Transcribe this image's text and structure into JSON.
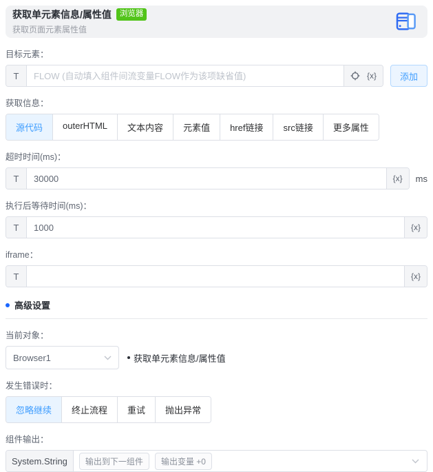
{
  "colors": {
    "accent": "#409eff",
    "accent_light_bg": "#ecf5ff",
    "badge_green": "#52c41a"
  },
  "tokens": {
    "text_prefix": "T",
    "variable": "{x}"
  },
  "header": {
    "title": "获取单元素信息/属性值",
    "badge": "浏览器",
    "subtitle": "获取页面元素属性值",
    "icon": "browser-window-icon"
  },
  "sections": {
    "target": {
      "label": "目标元素：",
      "placeholder": "FLOW (自动填入组件间流变量FLOW作为该项缺省值)",
      "add_button": "添加"
    },
    "info": {
      "label": "获取信息：",
      "options": [
        "源代码",
        "outerHTML",
        "文本内容",
        "元素值",
        "href链接",
        "src链接",
        "更多属性"
      ],
      "selected": "源代码"
    },
    "timeout": {
      "label": "超时时间(ms)：",
      "value": "30000",
      "unit": "ms"
    },
    "wait_after": {
      "label": "执行后等待时间(ms)：",
      "value": "1000"
    },
    "iframe": {
      "label": "iframe：",
      "value": ""
    },
    "advanced": {
      "title": "高级设置"
    },
    "current_object": {
      "label": "当前对象：",
      "value": "Browser1",
      "note": "获取单元素信息/属性值"
    },
    "on_error": {
      "label": "发生错误时：",
      "options": [
        "忽略继续",
        "终止流程",
        "重试",
        "抛出异常"
      ],
      "selected": "忽略继续"
    },
    "output": {
      "label": "组件输出：",
      "type": "System.String",
      "buttons": [
        "输出到下一组件",
        "输出变量 +0"
      ]
    }
  }
}
